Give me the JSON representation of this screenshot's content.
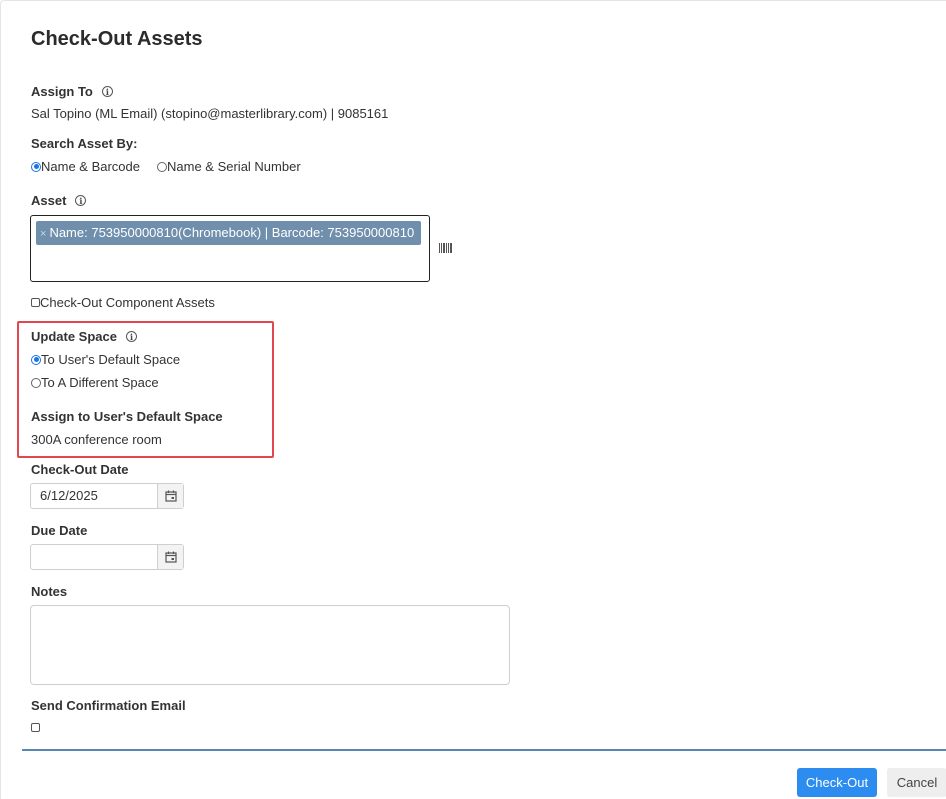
{
  "dialog": {
    "title": "Check-Out Assets"
  },
  "assign_to": {
    "label": "Assign To",
    "value": "Sal Topino (ML Email) (stopino@masterlibrary.com) | 9085161"
  },
  "search_by": {
    "label": "Search Asset By:",
    "options": [
      {
        "label": "Name & Barcode",
        "selected": true
      },
      {
        "label": "Name & Serial Number",
        "selected": false
      }
    ]
  },
  "asset": {
    "label": "Asset",
    "selected_tag": "Name: 753950000810(Chromebook) | Barcode: 753950000810",
    "remove_glyph": "×",
    "scan_icon": "barcode-icon"
  },
  "component_assets": {
    "label": "Check-Out Component Assets",
    "checked": false
  },
  "update_space": {
    "label": "Update Space",
    "options": [
      {
        "label": "To User's Default Space",
        "selected": true
      },
      {
        "label": "To A Different Space",
        "selected": false
      }
    ],
    "default_space_label": "Assign to User's Default Space",
    "default_space_value": "300A conference room",
    "highlight_color": "#e04850"
  },
  "checkout_date": {
    "label": "Check-Out Date",
    "value": "6/12/2025"
  },
  "due_date": {
    "label": "Due Date",
    "value": ""
  },
  "notes": {
    "label": "Notes",
    "value": ""
  },
  "confirmation_email": {
    "label": "Send Confirmation Email",
    "checked": false
  },
  "footer": {
    "checkout_label": "Check-Out",
    "cancel_label": "Cancel",
    "primary_color": "#2d8cf0"
  }
}
